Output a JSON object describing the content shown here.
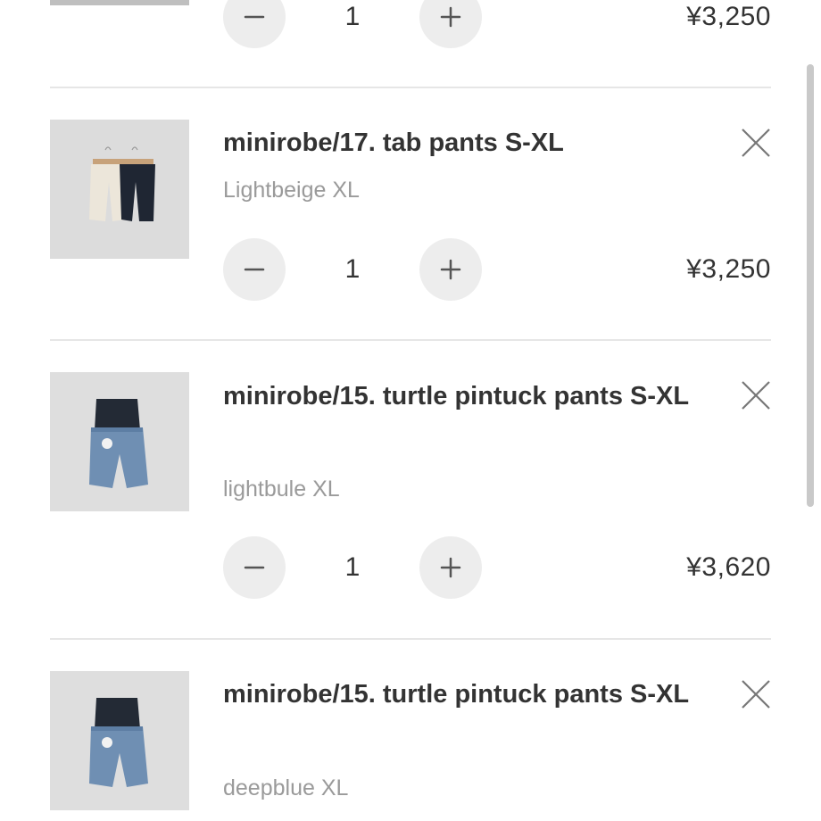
{
  "cart": {
    "partial_item": {
      "quantity": "1",
      "price": "¥3,250"
    },
    "items": [
      {
        "title": "minirobe/17. tab pants S-XL",
        "variant": "Lightbeige XL",
        "quantity": "1",
        "price": "¥3,250",
        "thumbnail": "tab-pants-photo"
      },
      {
        "title": "minirobe/15. turtle pintuck pants S-XL",
        "variant": "lightbule XL",
        "quantity": "1",
        "price": "¥3,620",
        "thumbnail": "turtle-pintuck-pants-photo"
      },
      {
        "title": "minirobe/15. turtle pintuck pants S-XL",
        "variant": "deepblue XL",
        "thumbnail": "turtle-pintuck-pants-photo"
      }
    ],
    "icons": {
      "remove": "close-icon",
      "decrease": "minus-icon",
      "increase": "plus-icon"
    }
  },
  "colors": {
    "text_primary": "#333333",
    "text_secondary": "#9a9a9a",
    "button_bg": "#ededed",
    "divider": "#e6e6e6"
  }
}
